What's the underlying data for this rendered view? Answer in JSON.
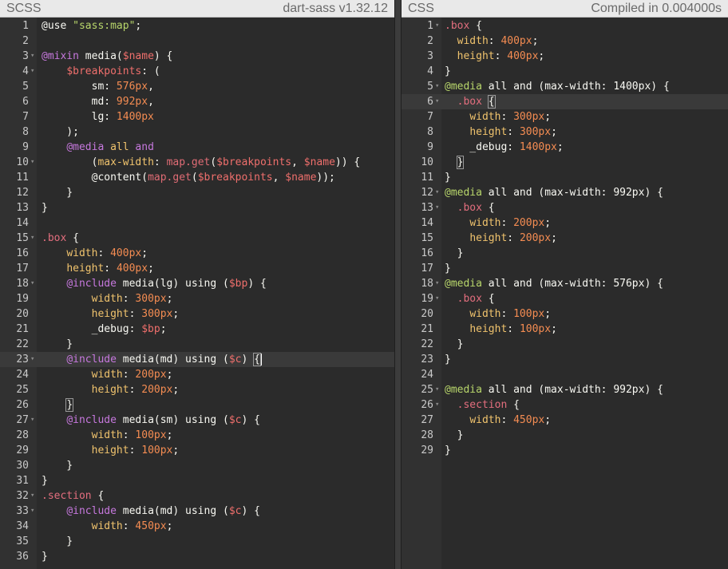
{
  "left": {
    "title": "SCSS",
    "meta": "dart-sass v1.32.12",
    "lines": [
      {
        "n": "1",
        "fold": false,
        "segs": [
          [
            "w",
            "@use "
          ],
          [
            "s",
            "\"sass:map\""
          ],
          [
            "w",
            ";"
          ]
        ]
      },
      {
        "n": "2",
        "fold": false,
        "segs": []
      },
      {
        "n": "3",
        "fold": true,
        "segs": [
          [
            "k",
            "@mixin"
          ],
          [
            "w",
            " media("
          ],
          [
            "v",
            "$name"
          ],
          [
            "w",
            ") {"
          ]
        ]
      },
      {
        "n": "4",
        "fold": true,
        "segs": [
          [
            "w",
            "    "
          ],
          [
            "v",
            "$breakpoints"
          ],
          [
            "w",
            ": ("
          ]
        ]
      },
      {
        "n": "5",
        "fold": false,
        "segs": [
          [
            "w",
            "        sm: "
          ],
          [
            "n",
            "576px"
          ],
          [
            "w",
            ","
          ]
        ]
      },
      {
        "n": "6",
        "fold": false,
        "segs": [
          [
            "w",
            "        md: "
          ],
          [
            "n",
            "992px"
          ],
          [
            "w",
            ","
          ]
        ]
      },
      {
        "n": "7",
        "fold": false,
        "segs": [
          [
            "w",
            "        lg: "
          ],
          [
            "n",
            "1400px"
          ]
        ]
      },
      {
        "n": "8",
        "fold": false,
        "segs": [
          [
            "w",
            "    );"
          ]
        ]
      },
      {
        "n": "9",
        "fold": false,
        "segs": [
          [
            "w",
            "    "
          ],
          [
            "k",
            "@media"
          ],
          [
            "w",
            " "
          ],
          [
            "p",
            "all"
          ],
          [
            "w",
            " "
          ],
          [
            "k",
            "and"
          ]
        ]
      },
      {
        "n": "10",
        "fold": true,
        "segs": [
          [
            "w",
            "        ("
          ],
          [
            "p",
            "max-width"
          ],
          [
            "w",
            ": "
          ],
          [
            "f",
            "map.get"
          ],
          [
            "w",
            "("
          ],
          [
            "v",
            "$breakpoints"
          ],
          [
            "w",
            ", "
          ],
          [
            "v",
            "$name"
          ],
          [
            "w",
            ")) {"
          ]
        ]
      },
      {
        "n": "11",
        "fold": false,
        "segs": [
          [
            "w",
            "        @content("
          ],
          [
            "f",
            "map.get"
          ],
          [
            "w",
            "("
          ],
          [
            "v",
            "$breakpoints"
          ],
          [
            "w",
            ", "
          ],
          [
            "v",
            "$name"
          ],
          [
            "w",
            "));"
          ]
        ]
      },
      {
        "n": "12",
        "fold": false,
        "segs": [
          [
            "w",
            "    }"
          ]
        ]
      },
      {
        "n": "13",
        "fold": false,
        "segs": [
          [
            "w",
            "}"
          ]
        ]
      },
      {
        "n": "14",
        "fold": false,
        "segs": []
      },
      {
        "n": "15",
        "fold": true,
        "segs": [
          [
            "sel",
            ".box"
          ],
          [
            "w",
            " {"
          ]
        ]
      },
      {
        "n": "16",
        "fold": false,
        "segs": [
          [
            "w",
            "    "
          ],
          [
            "p",
            "width"
          ],
          [
            "w",
            ": "
          ],
          [
            "n",
            "400px"
          ],
          [
            "w",
            ";"
          ]
        ]
      },
      {
        "n": "17",
        "fold": false,
        "segs": [
          [
            "w",
            "    "
          ],
          [
            "p",
            "height"
          ],
          [
            "w",
            ": "
          ],
          [
            "n",
            "400px"
          ],
          [
            "w",
            ";"
          ]
        ]
      },
      {
        "n": "18",
        "fold": true,
        "segs": [
          [
            "w",
            "    "
          ],
          [
            "k",
            "@include"
          ],
          [
            "w",
            " media(lg) using ("
          ],
          [
            "v",
            "$bp"
          ],
          [
            "w",
            ") {"
          ]
        ]
      },
      {
        "n": "19",
        "fold": false,
        "segs": [
          [
            "w",
            "        "
          ],
          [
            "p",
            "width"
          ],
          [
            "w",
            ": "
          ],
          [
            "n",
            "300px"
          ],
          [
            "w",
            ";"
          ]
        ]
      },
      {
        "n": "20",
        "fold": false,
        "segs": [
          [
            "w",
            "        "
          ],
          [
            "p",
            "height"
          ],
          [
            "w",
            ": "
          ],
          [
            "n",
            "300px"
          ],
          [
            "w",
            ";"
          ]
        ]
      },
      {
        "n": "21",
        "fold": false,
        "segs": [
          [
            "w",
            "        _debug: "
          ],
          [
            "v",
            "$bp"
          ],
          [
            "w",
            ";"
          ]
        ]
      },
      {
        "n": "22",
        "fold": false,
        "segs": [
          [
            "w",
            "    }"
          ]
        ]
      },
      {
        "n": "23",
        "fold": true,
        "active": true,
        "segs": [
          [
            "w",
            "    "
          ],
          [
            "k",
            "@include"
          ],
          [
            "w",
            " media(md) using ("
          ],
          [
            "v",
            "$c"
          ],
          [
            "w",
            ") "
          ],
          [
            "bm",
            "{"
          ]
        ],
        "cursor": true
      },
      {
        "n": "24",
        "fold": false,
        "segs": [
          [
            "w",
            "        "
          ],
          [
            "p",
            "width"
          ],
          [
            "w",
            ": "
          ],
          [
            "n",
            "200px"
          ],
          [
            "w",
            ";"
          ]
        ]
      },
      {
        "n": "25",
        "fold": false,
        "segs": [
          [
            "w",
            "        "
          ],
          [
            "p",
            "height"
          ],
          [
            "w",
            ": "
          ],
          [
            "n",
            "200px"
          ],
          [
            "w",
            ";"
          ]
        ]
      },
      {
        "n": "26",
        "fold": false,
        "segs": [
          [
            "w",
            "    "
          ],
          [
            "bm",
            "}"
          ]
        ]
      },
      {
        "n": "27",
        "fold": true,
        "segs": [
          [
            "w",
            "    "
          ],
          [
            "k",
            "@include"
          ],
          [
            "w",
            " media(sm) using ("
          ],
          [
            "v",
            "$c"
          ],
          [
            "w",
            ") {"
          ]
        ]
      },
      {
        "n": "28",
        "fold": false,
        "segs": [
          [
            "w",
            "        "
          ],
          [
            "p",
            "width"
          ],
          [
            "w",
            ": "
          ],
          [
            "n",
            "100px"
          ],
          [
            "w",
            ";"
          ]
        ]
      },
      {
        "n": "29",
        "fold": false,
        "segs": [
          [
            "w",
            "        "
          ],
          [
            "p",
            "height"
          ],
          [
            "w",
            ": "
          ],
          [
            "n",
            "100px"
          ],
          [
            "w",
            ";"
          ]
        ]
      },
      {
        "n": "30",
        "fold": false,
        "segs": [
          [
            "w",
            "    }"
          ]
        ]
      },
      {
        "n": "31",
        "fold": false,
        "segs": [
          [
            "w",
            "}"
          ]
        ]
      },
      {
        "n": "32",
        "fold": true,
        "segs": [
          [
            "sel",
            ".section"
          ],
          [
            "w",
            " {"
          ]
        ]
      },
      {
        "n": "33",
        "fold": true,
        "segs": [
          [
            "w",
            "    "
          ],
          [
            "k",
            "@include"
          ],
          [
            "w",
            " media(md) using ("
          ],
          [
            "v",
            "$c"
          ],
          [
            "w",
            ") {"
          ]
        ]
      },
      {
        "n": "34",
        "fold": false,
        "segs": [
          [
            "w",
            "        "
          ],
          [
            "p",
            "width"
          ],
          [
            "w",
            ": "
          ],
          [
            "n",
            "450px"
          ],
          [
            "w",
            ";"
          ]
        ]
      },
      {
        "n": "35",
        "fold": false,
        "segs": [
          [
            "w",
            "    }"
          ]
        ]
      },
      {
        "n": "36",
        "fold": false,
        "segs": [
          [
            "w",
            "}"
          ]
        ]
      }
    ]
  },
  "right": {
    "title": "CSS",
    "meta": "Compiled in 0.004000s",
    "lines": [
      {
        "n": "1",
        "fold": true,
        "segs": [
          [
            "sel",
            ".box"
          ],
          [
            "w",
            " {"
          ]
        ]
      },
      {
        "n": "2",
        "fold": false,
        "segs": [
          [
            "w",
            "  "
          ],
          [
            "p",
            "width"
          ],
          [
            "w",
            ": "
          ],
          [
            "n",
            "400px"
          ],
          [
            "w",
            ";"
          ]
        ]
      },
      {
        "n": "3",
        "fold": false,
        "segs": [
          [
            "w",
            "  "
          ],
          [
            "p",
            "height"
          ],
          [
            "w",
            ": "
          ],
          [
            "n",
            "400px"
          ],
          [
            "w",
            ";"
          ]
        ]
      },
      {
        "n": "4",
        "fold": false,
        "segs": [
          [
            "w",
            "}"
          ]
        ]
      },
      {
        "n": "5",
        "fold": true,
        "segs": [
          [
            "s",
            "@media"
          ],
          [
            "w",
            " all and (max-width: 1400px) {"
          ]
        ]
      },
      {
        "n": "6",
        "fold": true,
        "active": true,
        "segs": [
          [
            "w",
            "  "
          ],
          [
            "sel",
            ".box"
          ],
          [
            "w",
            " "
          ],
          [
            "bm",
            "{"
          ]
        ]
      },
      {
        "n": "7",
        "fold": false,
        "segs": [
          [
            "w",
            "    "
          ],
          [
            "p",
            "width"
          ],
          [
            "w",
            ": "
          ],
          [
            "n",
            "300px"
          ],
          [
            "w",
            ";"
          ]
        ]
      },
      {
        "n": "8",
        "fold": false,
        "segs": [
          [
            "w",
            "    "
          ],
          [
            "p",
            "height"
          ],
          [
            "w",
            ": "
          ],
          [
            "n",
            "300px"
          ],
          [
            "w",
            ";"
          ]
        ]
      },
      {
        "n": "9",
        "fold": false,
        "segs": [
          [
            "w",
            "    _debug: "
          ],
          [
            "n",
            "1400px"
          ],
          [
            "w",
            ";"
          ]
        ]
      },
      {
        "n": "10",
        "fold": false,
        "segs": [
          [
            "w",
            "  "
          ],
          [
            "bm",
            "}"
          ]
        ]
      },
      {
        "n": "11",
        "fold": false,
        "segs": [
          [
            "w",
            "}"
          ]
        ]
      },
      {
        "n": "12",
        "fold": true,
        "segs": [
          [
            "s",
            "@media"
          ],
          [
            "w",
            " all and (max-width: 992px) {"
          ]
        ]
      },
      {
        "n": "13",
        "fold": true,
        "segs": [
          [
            "w",
            "  "
          ],
          [
            "sel",
            ".box"
          ],
          [
            "w",
            " {"
          ]
        ]
      },
      {
        "n": "14",
        "fold": false,
        "segs": [
          [
            "w",
            "    "
          ],
          [
            "p",
            "width"
          ],
          [
            "w",
            ": "
          ],
          [
            "n",
            "200px"
          ],
          [
            "w",
            ";"
          ]
        ]
      },
      {
        "n": "15",
        "fold": false,
        "segs": [
          [
            "w",
            "    "
          ],
          [
            "p",
            "height"
          ],
          [
            "w",
            ": "
          ],
          [
            "n",
            "200px"
          ],
          [
            "w",
            ";"
          ]
        ]
      },
      {
        "n": "16",
        "fold": false,
        "segs": [
          [
            "w",
            "  }"
          ]
        ]
      },
      {
        "n": "17",
        "fold": false,
        "segs": [
          [
            "w",
            "}"
          ]
        ]
      },
      {
        "n": "18",
        "fold": true,
        "segs": [
          [
            "s",
            "@media"
          ],
          [
            "w",
            " all and (max-width: 576px) {"
          ]
        ]
      },
      {
        "n": "19",
        "fold": true,
        "segs": [
          [
            "w",
            "  "
          ],
          [
            "sel",
            ".box"
          ],
          [
            "w",
            " {"
          ]
        ]
      },
      {
        "n": "20",
        "fold": false,
        "segs": [
          [
            "w",
            "    "
          ],
          [
            "p",
            "width"
          ],
          [
            "w",
            ": "
          ],
          [
            "n",
            "100px"
          ],
          [
            "w",
            ";"
          ]
        ]
      },
      {
        "n": "21",
        "fold": false,
        "segs": [
          [
            "w",
            "    "
          ],
          [
            "p",
            "height"
          ],
          [
            "w",
            ": "
          ],
          [
            "n",
            "100px"
          ],
          [
            "w",
            ";"
          ]
        ]
      },
      {
        "n": "22",
        "fold": false,
        "segs": [
          [
            "w",
            "  }"
          ]
        ]
      },
      {
        "n": "23",
        "fold": false,
        "segs": [
          [
            "w",
            "}"
          ]
        ]
      },
      {
        "n": "24",
        "fold": false,
        "segs": []
      },
      {
        "n": "25",
        "fold": true,
        "segs": [
          [
            "s",
            "@media"
          ],
          [
            "w",
            " all and (max-width: 992px) {"
          ]
        ]
      },
      {
        "n": "26",
        "fold": true,
        "segs": [
          [
            "w",
            "  "
          ],
          [
            "sel",
            ".section"
          ],
          [
            "w",
            " {"
          ]
        ]
      },
      {
        "n": "27",
        "fold": false,
        "segs": [
          [
            "w",
            "    "
          ],
          [
            "p",
            "width"
          ],
          [
            "w",
            ": "
          ],
          [
            "n",
            "450px"
          ],
          [
            "w",
            ";"
          ]
        ]
      },
      {
        "n": "28",
        "fold": false,
        "segs": [
          [
            "w",
            "  }"
          ]
        ]
      },
      {
        "n": "29",
        "fold": false,
        "segs": [
          [
            "w",
            "}"
          ]
        ]
      }
    ]
  }
}
